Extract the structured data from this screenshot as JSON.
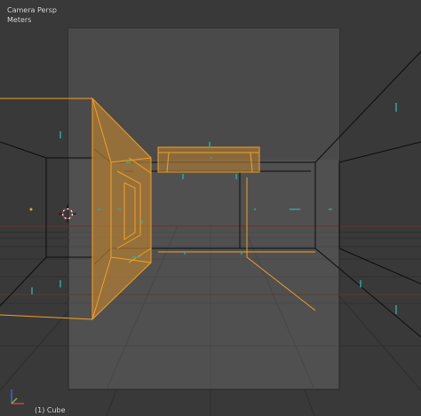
{
  "viewport": {
    "view_name": "Camera Persp",
    "unit_label": "Meters",
    "object_info": "(1) Cube"
  },
  "colors": {
    "background": "#393939",
    "camera_frame": "#505050",
    "grid": "#2c2c2c",
    "edges": "#0a0a0a",
    "selection": "#f5a020",
    "selection_fill": "#b07828",
    "x_axis": "#d04040",
    "y_axis": "#88b030",
    "normals": "#2ea89c",
    "origin_cursor": "#ffffff"
  },
  "icons": {
    "cursor": "3d-cursor-icon",
    "gizmo": "axis-gizmo-icon"
  }
}
